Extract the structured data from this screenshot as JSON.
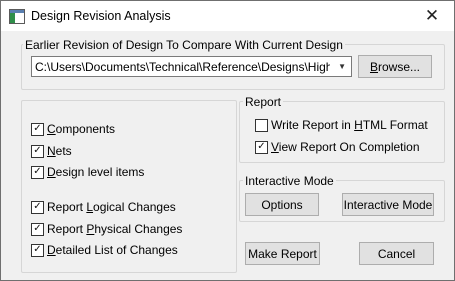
{
  "title": "Design Revision Analysis",
  "compare_group": {
    "label": "Earlier Revision of Design To Compare With Current Design",
    "path_value": "C:\\Users\\Documents\\Technical\\Reference\\Designs\\High",
    "browse_label": "Browse..."
  },
  "scope": {
    "components": "Components",
    "nets": "Nets",
    "design_level": "Design level items",
    "logical": "Report Logical Changes",
    "physical": "Report Physical Changes",
    "detailed": "Detailed List of Changes"
  },
  "report_group": {
    "label": "Report",
    "html_label": "Write Report in HTML Format",
    "view_label": "View Report On Completion",
    "html_checked": false,
    "view_checked": true
  },
  "interactive_group": {
    "label": "Interactive Mode",
    "options_label": "Options",
    "interactive_label": "Interactive Mode"
  },
  "footer": {
    "make_report": "Make Report",
    "cancel": "Cancel"
  }
}
